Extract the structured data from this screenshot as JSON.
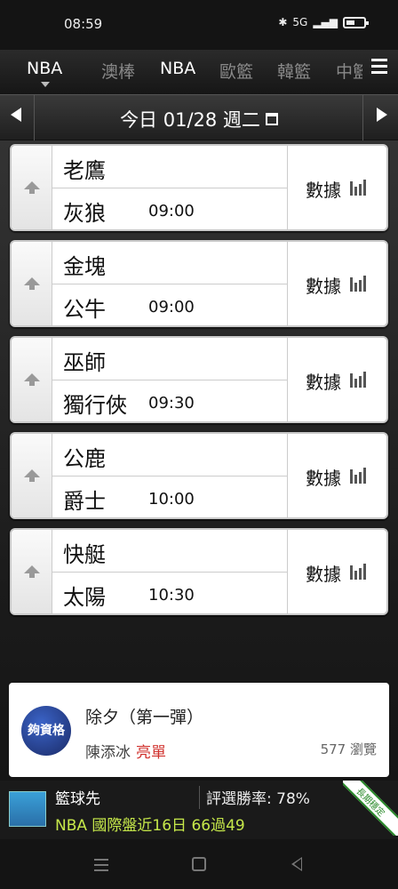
{
  "status_bar": {
    "time": "08:59",
    "network": "5G"
  },
  "league_tabs": {
    "current": "NBA",
    "items": [
      "澳棒",
      "NBA",
      "歐籃",
      "韓籃",
      "中籃"
    ]
  },
  "date_bar": {
    "label": "今日 01/28 週二"
  },
  "games": [
    {
      "away": "老鷹",
      "home": "灰狼",
      "time": "09:00",
      "stats_label": "數據"
    },
    {
      "away": "金塊",
      "home": "公牛",
      "time": "09:00",
      "stats_label": "數據"
    },
    {
      "away": "巫師",
      "home": "獨行俠",
      "time": "09:30",
      "stats_label": "數據"
    },
    {
      "away": "公鹿",
      "home": "爵士",
      "time": "10:00",
      "stats_label": "數據"
    },
    {
      "away": "快艇",
      "home": "太陽",
      "time": "10:30",
      "stats_label": "數據"
    }
  ],
  "news": {
    "avatar_text": "夠資格",
    "title": "除夕（第一彈）",
    "author": "陳添冰",
    "tag": "亮單",
    "views": "577 瀏覽"
  },
  "banner": {
    "name": "籃球先",
    "win_rate": "評選勝率: 78%",
    "record": "NBA 國際盤近16日 66過49",
    "ribbon": "長期穩定"
  },
  "colors": {
    "accent_red": "#d0312d",
    "record_green": "#c6e84a"
  }
}
